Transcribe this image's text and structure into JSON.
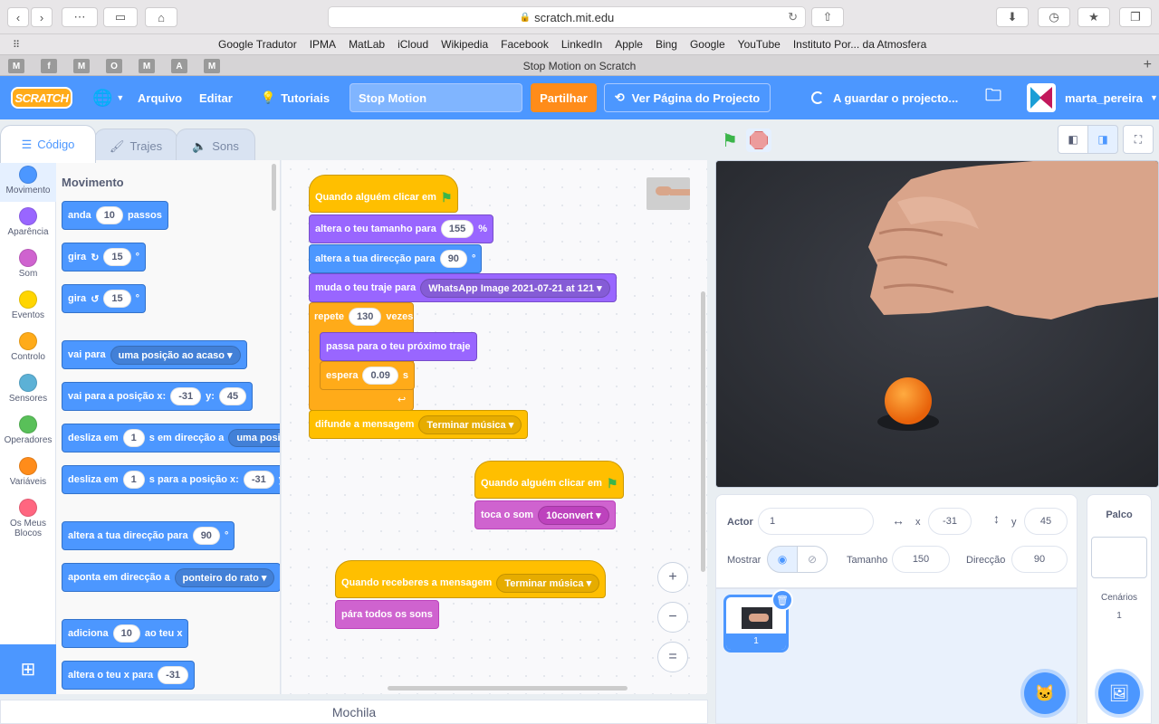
{
  "browser": {
    "url": "scratch.mit.edu",
    "tab_title": "Stop Motion on Scratch",
    "bookmarks": [
      "Google Tradutor",
      "IPMA",
      "MatLab",
      "iCloud",
      "Wikipedia",
      "Facebook",
      "LinkedIn",
      "Apple",
      "Bing",
      "Google",
      "YouTube",
      "Instituto Por... da Atmosfera"
    ],
    "pinned_tabs": [
      "M",
      "f",
      "M",
      "O",
      "M",
      "A",
      "M"
    ]
  },
  "menubar": {
    "logo": "SCRATCH",
    "file": "Arquivo",
    "edit": "Editar",
    "tutorials": "Tutoriais",
    "project_title": "Stop Motion",
    "share": "Partilhar",
    "see_project": "Ver Página do Projecto",
    "saving": "A guardar o projecto...",
    "username": "marta_pereira",
    "accent": "#4c97ff",
    "share_color": "#ff8c1a"
  },
  "editor_tabs": {
    "code": "Código",
    "costumes": "Trajes",
    "sounds": "Sons"
  },
  "categories": [
    {
      "label": "Movimento",
      "color": "#4c97ff"
    },
    {
      "label": "Aparência",
      "color": "#9966ff"
    },
    {
      "label": "Som",
      "color": "#cf63cf"
    },
    {
      "label": "Eventos",
      "color": "#ffd500"
    },
    {
      "label": "Controlo",
      "color": "#ffab19"
    },
    {
      "label": "Sensores",
      "color": "#5cb1d6"
    },
    {
      "label": "Operadores",
      "color": "#59c059"
    },
    {
      "label": "Variáveis",
      "color": "#ff8c1a"
    },
    {
      "label": "Os Meus Blocos",
      "color": "#ff6680"
    }
  ],
  "palette": {
    "heading": "Movimento",
    "b1": {
      "a": "anda",
      "v": "10",
      "b": "passos"
    },
    "b2": {
      "a": "gira",
      "v": "15",
      "b": "°"
    },
    "b3": {
      "a": "gira",
      "v": "15",
      "b": "°"
    },
    "b4": {
      "a": "vai para",
      "d": "uma posição ao acaso"
    },
    "b5": {
      "a": "vai para a posição x:",
      "x": "-31",
      "b": "y:",
      "y": "45"
    },
    "b6": {
      "a": "desliza em",
      "v": "1",
      "b": "s em direcção a",
      "d": "uma posiç"
    },
    "b7": {
      "a": "desliza em",
      "v": "1",
      "b": "s para a posição x:",
      "x": "-31",
      "c": "y"
    },
    "b8": {
      "a": "altera a tua direcção para",
      "v": "90",
      "b": "°"
    },
    "b9": {
      "a": "aponta em direcção a",
      "d": "ponteiro do rato"
    },
    "b10": {
      "a": "adiciona",
      "v": "10",
      "b": "ao teu x"
    },
    "b11": {
      "a": "altera o teu x para",
      "v": "-31"
    }
  },
  "scripts": {
    "s1": {
      "hat": "Quando alguém clicar em",
      "size_a": "altera o teu tamanho para",
      "size_v": "155",
      "size_b": "%",
      "dir_a": "altera a tua direcção para",
      "dir_v": "90",
      "dir_b": "°",
      "costume_a": "muda o teu traje para",
      "costume_d": "WhatsApp Image 2021-07-21 at 121",
      "repeat_a": "repete",
      "repeat_v": "130",
      "repeat_b": "vezes",
      "next": "passa para o teu próximo traje",
      "wait_a": "espera",
      "wait_v": "0.09",
      "wait_b": "s",
      "broadcast_a": "difunde a mensagem",
      "broadcast_d": "Terminar música"
    },
    "s2": {
      "hat": "Quando alguém clicar em",
      "sound_a": "toca o som",
      "sound_d": "10convert"
    },
    "s3": {
      "hat": "Quando receberes a mensagem",
      "hat_d": "Terminar música",
      "stop": "pára todos os sons"
    }
  },
  "zoom": {
    "in": "+",
    "out": "−",
    "reset": "="
  },
  "sprite_info": {
    "actor_label": "Actor",
    "actor_name": "1",
    "x_label": "x",
    "x": "-31",
    "y_label": "y",
    "y": "45",
    "show_label": "Mostrar",
    "size_label": "Tamanho",
    "size": "150",
    "direction_label": "Direcção",
    "direction": "90"
  },
  "sprite_list": {
    "sprite_name": "1"
  },
  "stage_panel": {
    "title": "Palco",
    "backdrops_label": "Cenários",
    "backdrops_count": "1"
  },
  "backpack": "Mochila"
}
